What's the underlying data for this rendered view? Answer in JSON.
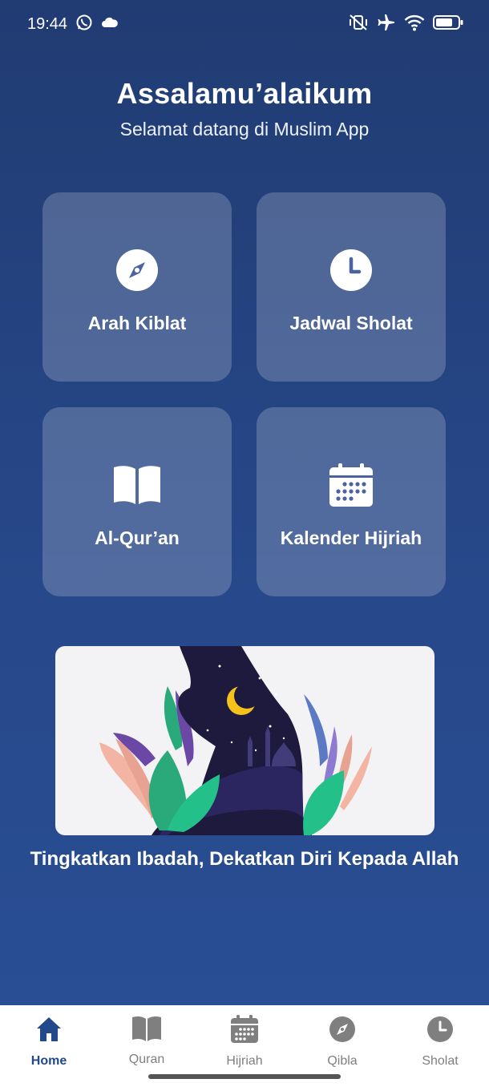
{
  "status_bar": {
    "time": "19:44",
    "left_icons": [
      "whatsapp-icon",
      "cloud-icon"
    ],
    "right_icons": [
      "vibrate-off-icon",
      "airplane-icon",
      "wifi-icon",
      "battery-icon"
    ]
  },
  "header": {
    "greeting": "Assalamu’alaikum",
    "subtitle": "Selamat datang di Muslim App"
  },
  "menu": [
    {
      "label": "Arah Kiblat",
      "icon": "compass-icon"
    },
    {
      "label": "Jadwal Sholat",
      "icon": "clock-icon"
    },
    {
      "label": "Al-Qur’an",
      "icon": "book-icon"
    },
    {
      "label": "Kalender Hijriah",
      "icon": "calendar-icon"
    }
  ],
  "banner": {
    "image": "praying-silhouette-illustration"
  },
  "tagline": "Tingkatkan Ibadah, Dekatkan Diri Kepada Allah",
  "bottom_nav": {
    "items": [
      {
        "label": "Home",
        "icon": "home-icon",
        "active": true
      },
      {
        "label": "Quran",
        "icon": "book-icon",
        "active": false
      },
      {
        "label": "Hijriah",
        "icon": "calendar-icon",
        "active": false
      },
      {
        "label": "Qibla",
        "icon": "compass-icon",
        "active": false
      },
      {
        "label": "Sholat",
        "icon": "clock-icon",
        "active": false
      }
    ]
  },
  "colors": {
    "background_top": "#213c73",
    "background_bottom": "#2a4f96",
    "nav_active": "#23498d",
    "nav_inactive": "#7f7f7f"
  }
}
